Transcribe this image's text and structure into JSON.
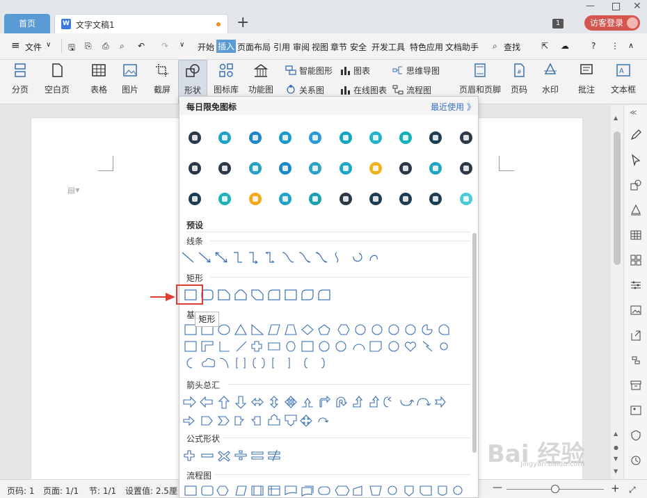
{
  "tabs": {
    "home": "首页",
    "doc_title": "文字文稿1",
    "doc_icon_letter": "W",
    "window_badge": "1",
    "login": "访客登录"
  },
  "menu": {
    "file": "文件",
    "items": [
      "开始",
      "插入",
      "页面布局",
      "引用",
      "审阅",
      "视图",
      "章节",
      "安全",
      "开发工具",
      "特色应用",
      "文档助手"
    ],
    "active": "插入",
    "search": "查找"
  },
  "ribbon": {
    "page_break": "分页",
    "blank_page": "空白页",
    "table": "表格",
    "picture": "图片",
    "screenshot": "截屏",
    "shape": "形状",
    "icon_lib": "图标库",
    "func_chart": "功能图",
    "smart_graphic": "智能图形",
    "chart": "图表",
    "mindmap": "思维导图",
    "relation": "关系图",
    "online_chart": "在线图表",
    "flowchart": "流程图",
    "header_footer": "页眉和页脚",
    "page_num": "页码",
    "watermark": "水印",
    "comment": "批注",
    "textbox": "文本框"
  },
  "panel": {
    "header": "每日限免图标",
    "recent": "最近使用 》",
    "icon_colors": [
      "#2b3a4a",
      "#1fa2c8",
      "#1b88c9",
      "#1a9ac9",
      "#2b9ad8",
      "#14a5c0",
      "#1fb3c9",
      "#12b0b8",
      "#1f3d52",
      "#2a3848",
      "#2a3848",
      "#2a3848",
      "#2aa0c4",
      "#1b89c6",
      "#2aa3c7",
      "#1ea6c8",
      "#f0b21a",
      "#2b3848",
      "#1fa6c4",
      "#2b3848",
      "#1f3d52",
      "#1fb3b8",
      "#f2a91a",
      "#1fa3c8",
      "#1aa0b0",
      "#2b3848",
      "#1f3d52",
      "#1f3d52",
      "#1f3d52",
      "#4ec9d8"
    ],
    "preset": "预设",
    "lines": "线条",
    "rect": "矩形",
    "basic": "基",
    "arrows": "箭头总汇",
    "formula": "公式形状",
    "flow": "流程图"
  },
  "tooltip": "矩形",
  "status": {
    "page": "页码: 1",
    "pages": "页面: 1/1",
    "section": "节: 1/1",
    "setting": "设置值: 2.5厘米"
  },
  "watermark": {
    "logo": "Bai 经验",
    "url": "jingyan.baidu.com"
  },
  "colors": {
    "accent": "#5b9bd5",
    "login": "#d5554f",
    "highlight": "#e03c31",
    "shape_stroke": "#3a6fb0"
  }
}
